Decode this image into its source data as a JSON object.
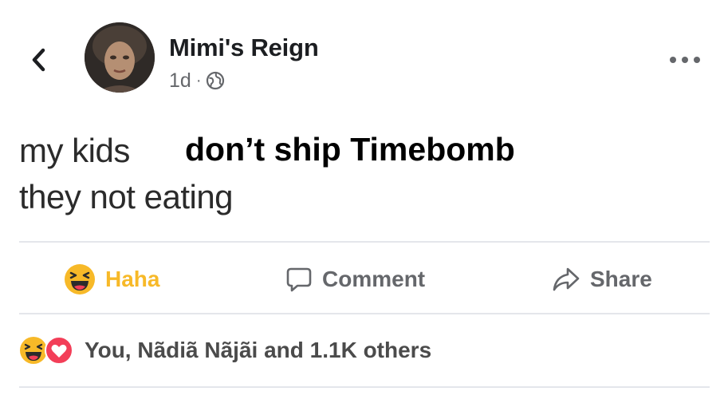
{
  "header": {
    "author_name": "Mimi's Reign",
    "timestamp": "1d",
    "separator": "·",
    "audience_icon": "globe-icon",
    "back_icon": "chevron-left-icon",
    "more_icon": "ellipsis-icon"
  },
  "post": {
    "text_line_1": "my kids",
    "text_line_2": "they not eating",
    "overlay_caption": "don’t ship Timebomb"
  },
  "actions": {
    "haha_label": "Haha",
    "comment_label": "Comment",
    "share_label": "Share"
  },
  "reactions": {
    "icons": [
      "haha-emoji-icon",
      "love-heart-icon"
    ],
    "summary": "You, Nãdiã Nãjãi and 1.1K others"
  },
  "colors": {
    "haha_yellow": "#f7b928",
    "love_red": "#f33e58",
    "secondary_text": "#65676b",
    "divider": "#e4e6eb"
  }
}
